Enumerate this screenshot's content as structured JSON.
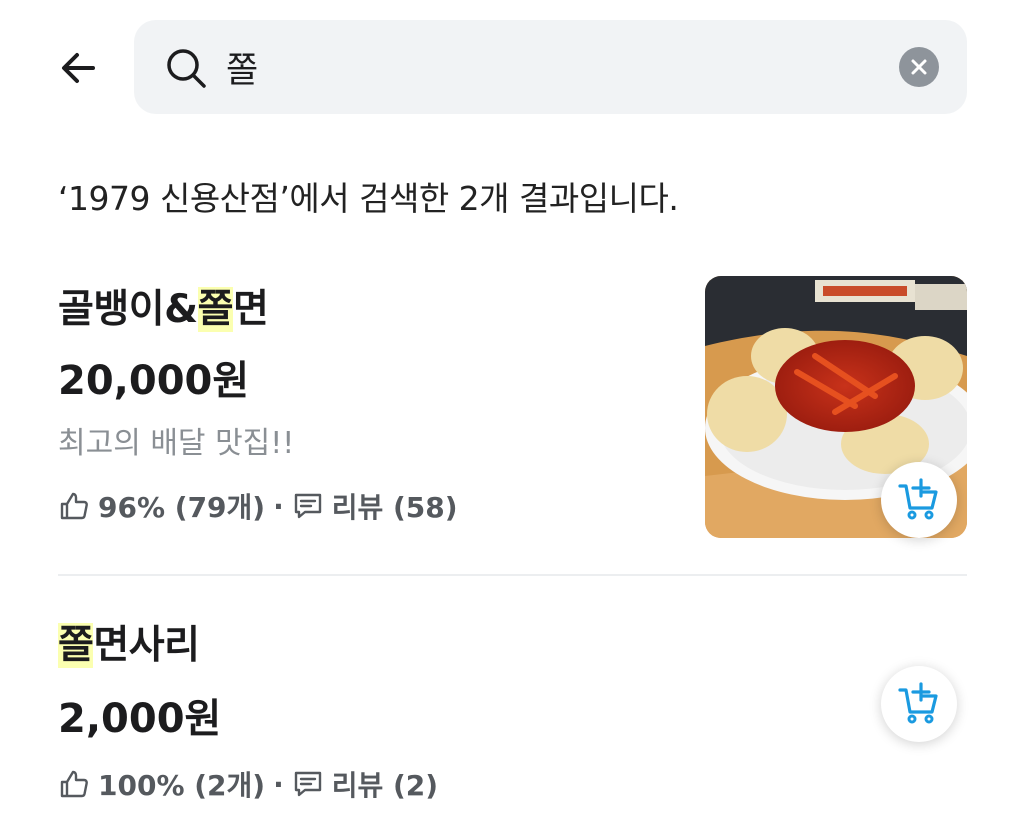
{
  "search": {
    "query": "쫄",
    "placeholder": ""
  },
  "summary": "‘1979 신용산점’에서 검색한 2개 결과입니다.",
  "items": [
    {
      "title_before": "골뱅이&",
      "title_highlight": "쫄",
      "title_after": "면",
      "price": "20,000원",
      "description": "최고의 배달 맛집!!",
      "rating": "96% (79개)",
      "separator": "·",
      "reviews": "리뷰 (58)"
    },
    {
      "title_before": "",
      "title_highlight": "쫄",
      "title_after": "면사리",
      "price": "2,000원",
      "rating": "100% (2개)",
      "separator": "·",
      "reviews": "리뷰 (2)"
    }
  ],
  "colors": {
    "accent": "#1a9ae0",
    "highlight": "#fbffb0",
    "search_bg": "#f1f3f5"
  },
  "icons": {
    "back": "arrow-left-icon",
    "search": "search-icon",
    "clear": "close-circle-icon",
    "like": "thumbs-up-icon",
    "review": "comment-icon",
    "cart": "cart-plus-icon"
  }
}
